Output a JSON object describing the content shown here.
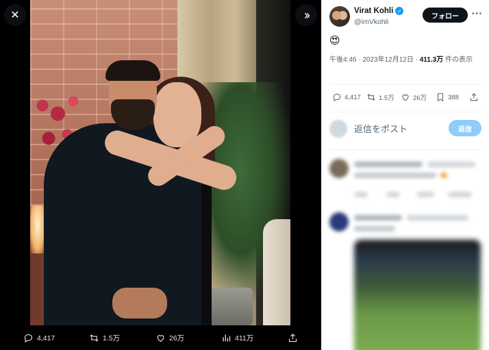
{
  "viewer": {
    "close_icon": "close-icon",
    "expand_icon": "chevron-double-right-icon",
    "actions": [
      {
        "name": "reply",
        "icon": "reply-icon",
        "count": "4,417"
      },
      {
        "name": "repost",
        "icon": "repost-icon",
        "count": "1.5万"
      },
      {
        "name": "like",
        "icon": "heart-icon",
        "count": "26万"
      },
      {
        "name": "views",
        "icon": "views-icon",
        "count": "411万"
      },
      {
        "name": "share",
        "icon": "share-icon",
        "count": ""
      }
    ]
  },
  "tweet": {
    "author_name": "Virat Kohli",
    "author_handle": "@imVkohli",
    "follow_label": "フォロー",
    "more_label": "···",
    "emoji": "😍",
    "time": "午後4:46 · 2023年12月12日 · ",
    "views_count": "411.3万",
    "views_suffix": " 件の表示",
    "stats": {
      "replies": "4,417",
      "reposts": "1.5万",
      "likes": "26万",
      "bookmarks": "388"
    },
    "reply_placeholder": "返信をポスト",
    "reply_button": "返信"
  },
  "colors": {
    "accent": "#1d9bf0",
    "reply_button_disabled": "#8ecdf8",
    "follow_button": "#0f1419"
  }
}
